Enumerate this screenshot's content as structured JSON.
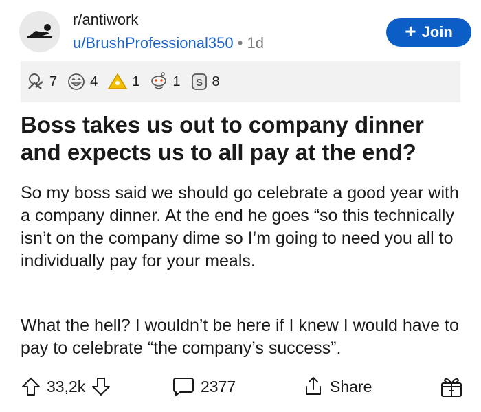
{
  "post": {
    "subreddit": "r/antiwork",
    "author": "u/BrushProfessional350",
    "age": "1d",
    "title": "Boss takes us out to company dinner and expects us to all pay at the end?",
    "paragraphs": [
      "So my boss said we should go celebrate a good year with a company dinner. At the end he goes “so this technically isn’t on the company dime so I’m going to need you all to individually pay for your meals.",
      "What the hell? I wouldn’t be here if I knew I would have to pay to celebrate “the company’s success”."
    ]
  },
  "header": {
    "join_label": "Join"
  },
  "awards": [
    {
      "icon": "hands-award-icon",
      "count": "7"
    },
    {
      "icon": "laughing-face-award-icon",
      "count": "4"
    },
    {
      "icon": "gold-pyramid-award-icon",
      "count": "1"
    },
    {
      "icon": "snoo-award-icon",
      "count": "1"
    },
    {
      "icon": "silver-coin-award-icon",
      "count": "8"
    }
  ],
  "footer": {
    "votes": "33,2k",
    "comments": "2377",
    "share_label": "Share"
  },
  "colors": {
    "join": "#0b5ec6",
    "link": "#1c63c7",
    "award_bar": "#f2f2f2"
  }
}
